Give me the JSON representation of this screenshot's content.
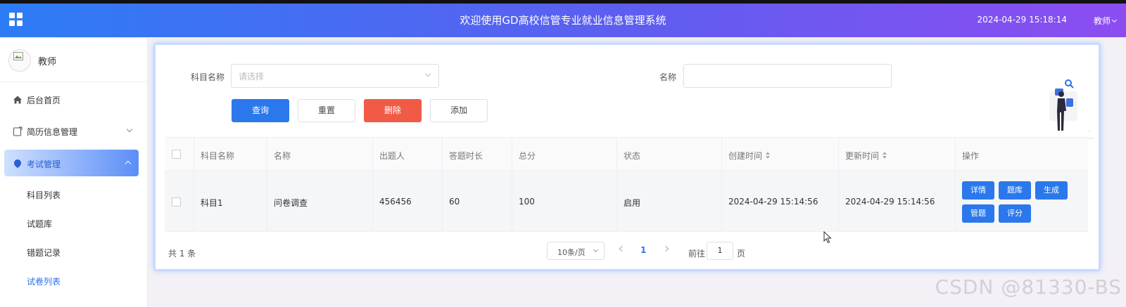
{
  "header": {
    "title": "欢迎使用GD高校信管专业就业信息管理系统",
    "datetime": "2024-04-29 15:18:14",
    "user": "教师"
  },
  "sidebar": {
    "user_name": "教师",
    "items": [
      {
        "label": "后台首页",
        "icon": "home-icon"
      },
      {
        "label": "简历信息管理",
        "icon": "resume-icon"
      },
      {
        "label": "考试管理",
        "icon": "exam-icon"
      }
    ],
    "sub_items": [
      {
        "label": "科目列表"
      },
      {
        "label": "试题库"
      },
      {
        "label": "错题记录"
      },
      {
        "label": "试卷列表"
      }
    ]
  },
  "search": {
    "subject_label": "科目名称",
    "subject_placeholder": "请选择",
    "name_label": "名称",
    "name_value": ""
  },
  "toolbar": {
    "query": "查询",
    "reset": "重置",
    "delete": "删除",
    "add": "添加"
  },
  "table": {
    "columns": [
      "科目名称",
      "名称",
      "出题人",
      "答题时长",
      "总分",
      "状态",
      "创建时间",
      "更新时间",
      "操作"
    ],
    "rows": [
      {
        "subject": "科目1",
        "name": "问卷调查",
        "author": "456456",
        "duration": "60",
        "score": "100",
        "status": "启用",
        "created": "2024-04-29 15:14:56",
        "updated": "2024-04-29 15:14:56",
        "actions": [
          "详情",
          "题库",
          "生成",
          "管题",
          "评分"
        ]
      }
    ]
  },
  "pagination": {
    "total": "共 1 条",
    "page_size": "10条/页",
    "current_page": "1",
    "goto_label": "前往",
    "goto_value": "1",
    "goto_suffix": "页"
  },
  "watermark": "CSDN @81330-BS",
  "colors": {
    "primary": "#2b78ec",
    "danger": "#f15b45",
    "header_start": "#2d7cf6",
    "header_end": "#8c4df0"
  }
}
